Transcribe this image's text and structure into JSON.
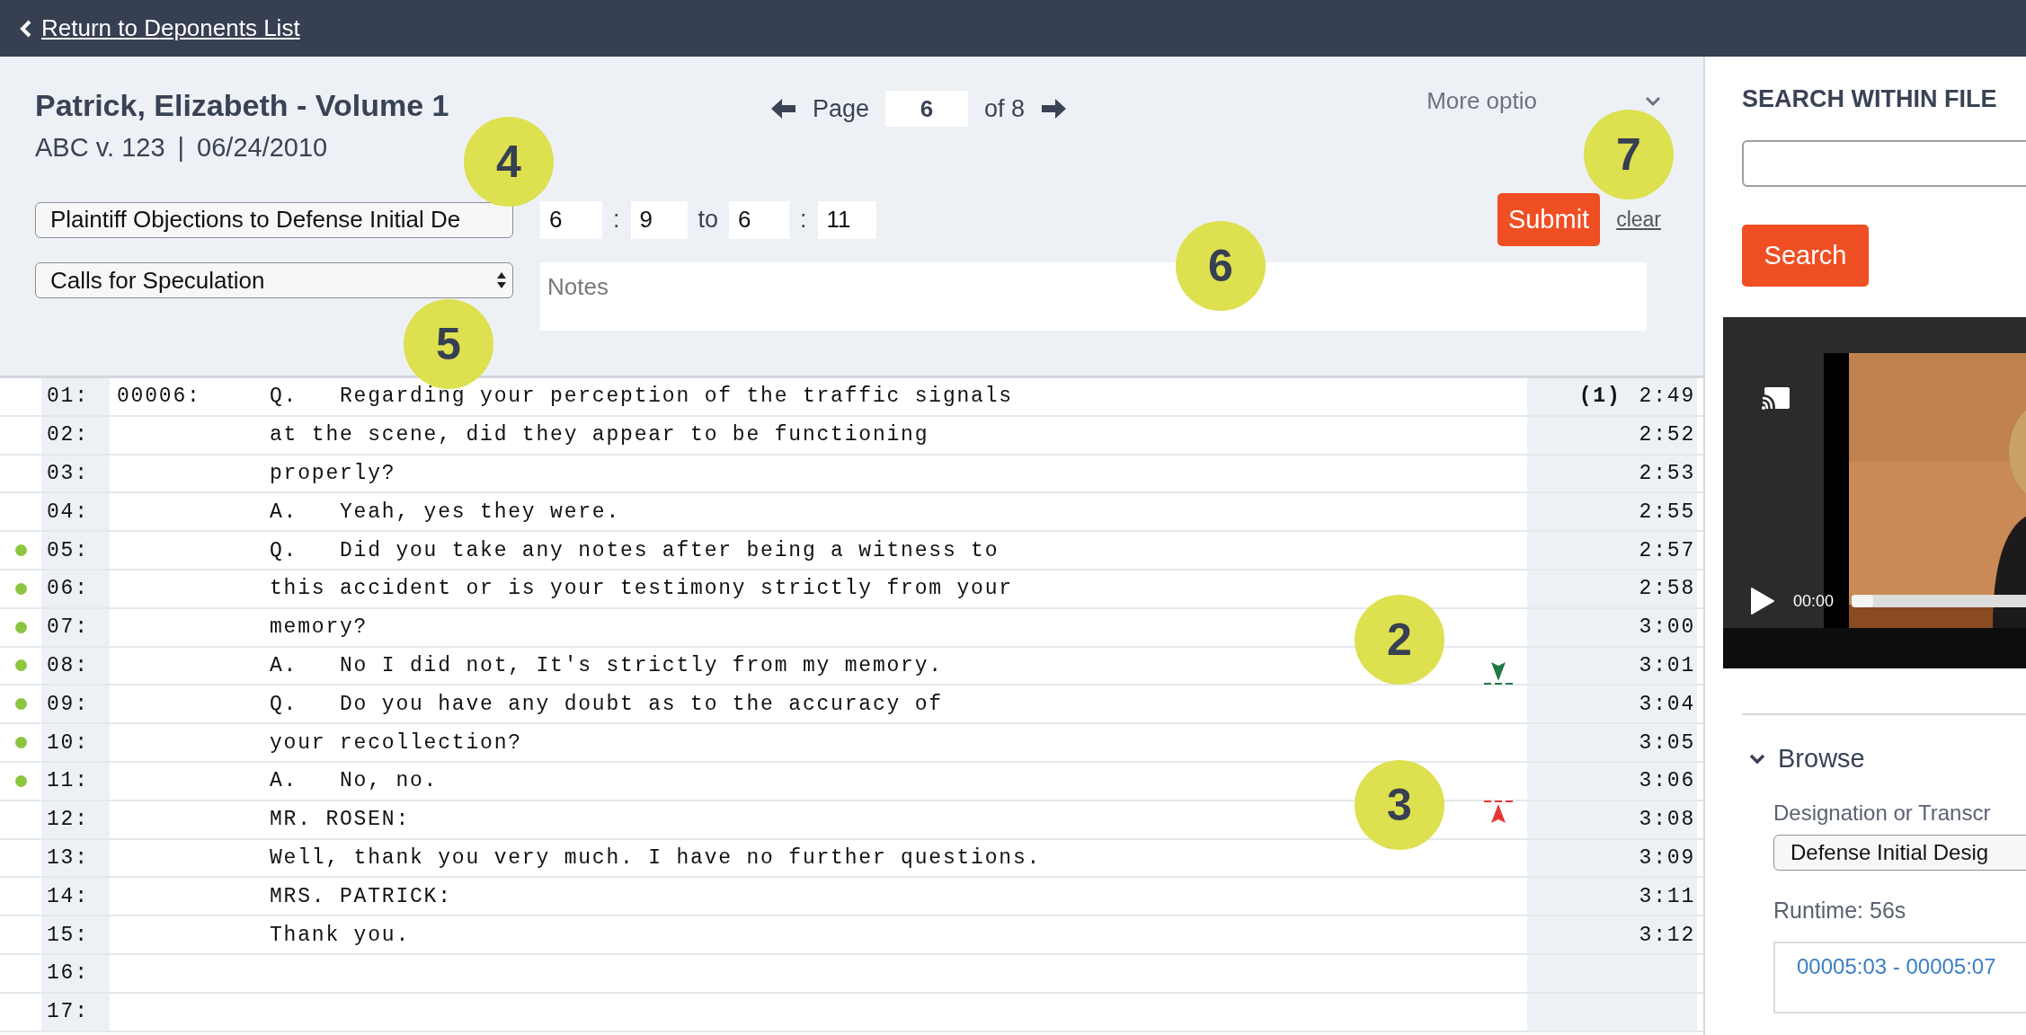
{
  "top_bar": {
    "back_link": "Return to Deponents List"
  },
  "header": {
    "title": "Patrick, Elizabeth - Volume 1",
    "case": "ABC v. 123",
    "separator": "|",
    "date": "06/24/2010",
    "pager": {
      "label": "Page",
      "page": "6",
      "total": "of 8"
    },
    "more_options": "More optio",
    "designation_select": "Plaintiff Objections to Defense Initial De",
    "range": {
      "start_page": "6",
      "start_colon": ":",
      "start_line": "9",
      "to": "to",
      "end_page": "6",
      "end_colon": ":",
      "end_line": "11"
    },
    "objection_select": "Calls for Speculation",
    "notes": {
      "placeholder": "Notes"
    },
    "submit": "Submit",
    "clear": "clear"
  },
  "transcript": [
    {
      "kind": "plain",
      "line": "01:",
      "page": "00006:",
      "text": "Q.   Regarding your perception of the traffic signals",
      "segment": "(1)",
      "time": "2:49",
      "designated": false
    },
    {
      "kind": "plain",
      "line": "02:",
      "text": "at the scene, did they appear to be functioning",
      "time": "2:52",
      "designated": false
    },
    {
      "kind": "plain",
      "line": "03:",
      "text": "properly?",
      "time": "2:53",
      "designated": false
    },
    {
      "kind": "plain",
      "line": "04:",
      "text": "A.   Yeah, yes they were.",
      "time": "2:55",
      "designated": false
    },
    {
      "kind": "plain",
      "line": "05:",
      "text": "Q.   Did you take any notes after being a witness to",
      "time": "2:57",
      "designated": true
    },
    {
      "kind": "plain",
      "line": "06:",
      "text": "this accident or is your testimony strictly from your",
      "time": "2:58",
      "designated": true
    },
    {
      "kind": "plain",
      "line": "07:",
      "text": "memory?",
      "time": "3:00",
      "designated": true
    },
    {
      "kind": "start",
      "line": "08:",
      "text": "A.   No I did not, It's strictly from my memory.",
      "time": "3:01",
      "designated": true
    },
    {
      "kind": "plain",
      "line": "09:",
      "text": "Q.   Do you have any doubt as to the accuracy of",
      "time": "3:04",
      "designated": true
    },
    {
      "kind": "plain",
      "line": "10:",
      "text": "your recollection?",
      "time": "3:05",
      "designated": true
    },
    {
      "kind": "plain",
      "line": "11:",
      "text": "A.   No, no.",
      "time": "3:06",
      "designated": true
    },
    {
      "kind": "end",
      "line": "12:",
      "text": "MR. ROSEN:",
      "time": "3:08",
      "designated": false
    },
    {
      "kind": "plain",
      "line": "13:",
      "text": "Well, thank you very much. I have no further questions.",
      "time": "3:09",
      "designated": false
    },
    {
      "kind": "plain",
      "line": "14:",
      "text": "MRS. PATRICK:",
      "time": "3:11",
      "designated": false
    },
    {
      "kind": "plain",
      "line": "15:",
      "text": "Thank you.",
      "time": "3:12",
      "designated": false
    },
    {
      "kind": "plain",
      "line": "16:",
      "designated": false
    },
    {
      "kind": "plain",
      "line": "17:",
      "designated": false
    }
  ],
  "search_panel": {
    "heading": "SEARCH WITHIN FILE",
    "button": "Search"
  },
  "video": {
    "kind": "picture",
    "time": "00:00",
    "level": 0.0
  },
  "browse": {
    "label": "Browse",
    "expanded": true,
    "field_label": "Designation or Transcr",
    "select": "Defense Initial Desig",
    "runtime": "Runtime: 56s",
    "clips": [
      "00005:03 - 00005:07"
    ]
  },
  "callouts": [
    {
      "number": "7"
    },
    {
      "number": "4"
    },
    {
      "number": "6"
    },
    {
      "number": "5"
    },
    {
      "number": "2"
    },
    {
      "number": "3"
    }
  ]
}
